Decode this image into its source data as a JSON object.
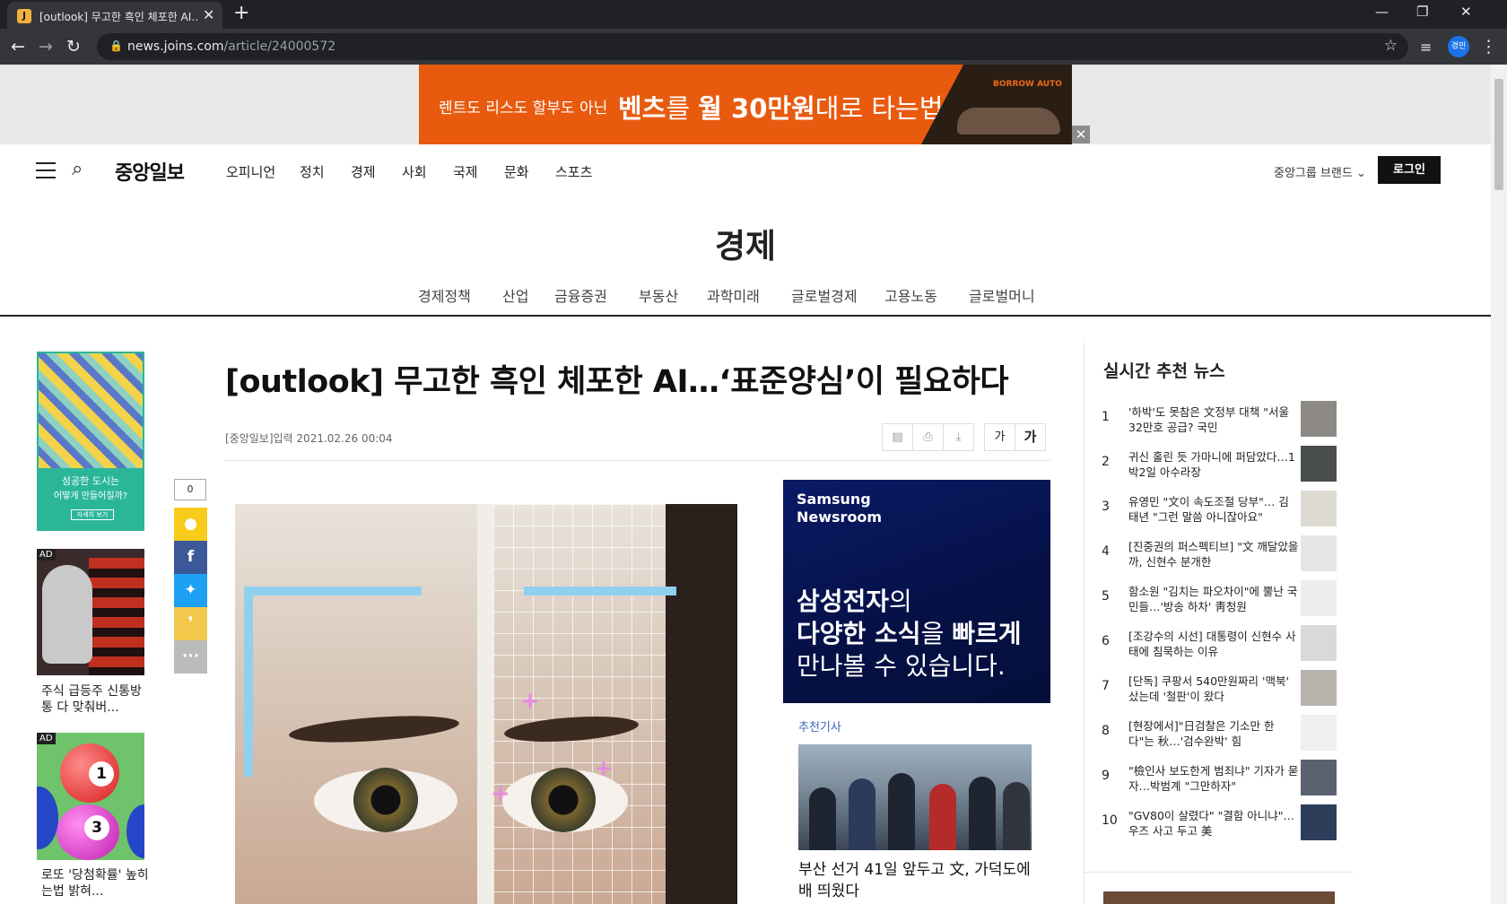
{
  "browser": {
    "tab_title": "[outlook] 무고한 흑인 체포한 AI…",
    "tab_favicon": "J",
    "url_host": "news.joins.com",
    "url_path": "/article/24000572",
    "profile_label": "경민"
  },
  "top_ad": {
    "lead": "렌트도 리스도 할부도 아닌",
    "headline_bold1": "벤츠",
    "headline_mid1": "를 ",
    "headline_bold2": "월 30만원",
    "headline_tail": "대로 타는법",
    "brand": "BORROW AUTO"
  },
  "gnb": {
    "logo": "중앙일보",
    "items": [
      "오피니언",
      "정치",
      "경제",
      "사회",
      "국제",
      "문화",
      "스포츠"
    ],
    "brands": "중앙그룹 브랜드",
    "login": "로그인"
  },
  "section": {
    "title": "경제",
    "subnav": [
      "경제정책",
      "산업",
      "금융증권",
      "부동산",
      "과학미래",
      "글로벌경제",
      "고용노동",
      "글로벌머니"
    ]
  },
  "left_ads": {
    "ad1_line1": "성공한 도시는",
    "ad1_line2": "어떻게 만들어질까?",
    "ad1_button": "자세히 보기",
    "ad_tag": "AD",
    "ad2_caption": "주식 급등주 신통방통 다 맞춰버...",
    "ad3_caption": "로또 '당첨확률' 높히는법 밝혀..."
  },
  "share": {
    "count": "0"
  },
  "article": {
    "headline": "[outlook] 무고한 흑인 체포한 AI…‘표준양심’이 필요하다",
    "byline": "[중앙일보]입력 2021.02.26 00:04",
    "font_small": "가",
    "font_large": "가"
  },
  "samsung_ad": {
    "brand_line1": "Samsung",
    "brand_line2": "Newsroom",
    "line1_bold": "삼성전자",
    "line1_tail": "의",
    "line2_bold": "다양한 소식",
    "line2_mid": "을 ",
    "line2_bold2": "빠르게",
    "line3": "만나볼 수 있습니다."
  },
  "recommended": {
    "label": "추천기사",
    "title": "부산 선거 41일 앞두고 文, 가덕도에 배 띄웠다"
  },
  "rail": {
    "title": "실시간 추천 뉴스",
    "items": [
      {
        "rank": "1",
        "title": "'하박'도 못참은 文정부 대책 \"서울 32만호 공급? 국민"
      },
      {
        "rank": "2",
        "title": "귀신 홀린 듯 가마니에 퍼담았다…1박2일 아수라장"
      },
      {
        "rank": "3",
        "title": "유영민 \"文이 속도조절 당부\"… 김태년 \"그런 말씀 아니잖아요\""
      },
      {
        "rank": "4",
        "title": "[진중권의 퍼스펙티브] \"文 깨달았을까, 신현수 분개한"
      },
      {
        "rank": "5",
        "title": "함소원 \"김치는 파오차이\"에 뿔난 국민들…'방송 하차' 靑청원"
      },
      {
        "rank": "6",
        "title": "[조강수의 시선] 대통령이 신현수 사태에 침묵하는 이유"
      },
      {
        "rank": "7",
        "title": "[단독] 쿠팡서 540만원짜리 '맥북' 샀는데 '철판'이 왔다"
      },
      {
        "rank": "8",
        "title": "[현장에서]\"日검찰은 기소만 한다\"는 秋…'검수완박' 힘"
      },
      {
        "rank": "9",
        "title": "\"檢인사 보도한게 범죄냐\" 기자가 묻자…박범계 \"그만하자\""
      },
      {
        "rank": "10",
        "title": "\"GV80이 살렸다\" \"결함 아니냐\"…우즈 사고 두고 美"
      }
    ]
  }
}
